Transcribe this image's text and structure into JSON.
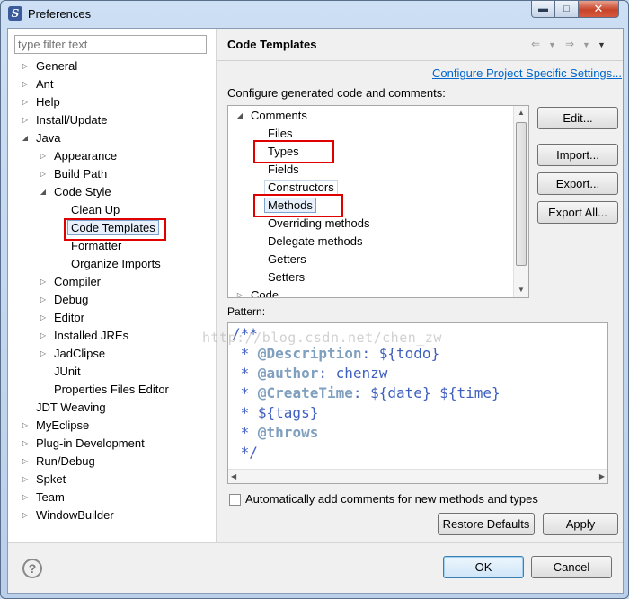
{
  "window": {
    "title": "Preferences",
    "min_icon": "minimize-icon",
    "max_icon": "maximize-icon",
    "close_icon": "close-icon"
  },
  "filter": {
    "placeholder": "type filter text"
  },
  "tree": {
    "general": "General",
    "ant": "Ant",
    "help": "Help",
    "install_update": "Install/Update",
    "java": "Java",
    "appearance": "Appearance",
    "build_path": "Build Path",
    "code_style": "Code Style",
    "clean_up": "Clean Up",
    "code_templates": "Code Templates",
    "formatter": "Formatter",
    "organize_imports": "Organize Imports",
    "compiler": "Compiler",
    "debug": "Debug",
    "editor": "Editor",
    "installed_jres": "Installed JREs",
    "jadclipse": "JadClipse",
    "junit": "JUnit",
    "properties_files_editor": "Properties Files Editor",
    "jdt_weaving": "JDT Weaving",
    "myeclipse": "MyEclipse",
    "plugin_development": "Plug-in Development",
    "run_debug": "Run/Debug",
    "spket": "Spket",
    "team": "Team",
    "windowbuilder": "WindowBuilder"
  },
  "page": {
    "title": "Code Templates",
    "configure_link": "Configure Project Specific Settings...",
    "description": "Configure generated code and comments:"
  },
  "templates": {
    "comments": "Comments",
    "files": "Files",
    "types": "Types",
    "fields": "Fields",
    "constructors": "Constructors",
    "methods": "Methods",
    "overriding_methods": "Overriding methods",
    "delegate_methods": "Delegate methods",
    "getters": "Getters",
    "setters": "Setters",
    "code": "Code"
  },
  "buttons": {
    "edit": "Edit...",
    "import": "Import...",
    "export": "Export...",
    "export_all": "Export All...",
    "restore_defaults": "Restore Defaults",
    "apply": "Apply",
    "ok": "OK",
    "cancel": "Cancel"
  },
  "pattern": {
    "label": "Pattern:",
    "lines": [
      "/**",
      " * ",
      " * ",
      " * ",
      " * ${tags}",
      " * ",
      " */"
    ],
    "tag_description": "@Description",
    "text_description": ": ${todo}",
    "tag_author": "@author",
    "text_author": ": chenzw",
    "tag_createtime": "@CreateTime",
    "text_createtime": ": ${date} ${time}",
    "tag_throws": "@throws"
  },
  "auto_comments": {
    "label": "Automatically add comments for new methods and types",
    "checked": false
  },
  "watermark": "http://blog.csdn.net/chen_zw",
  "colors": {
    "highlight_red": "#e00000",
    "link_blue": "#0066cc",
    "code_blue": "#3f5fbf",
    "tag_gray_blue": "#7f9fbf"
  }
}
